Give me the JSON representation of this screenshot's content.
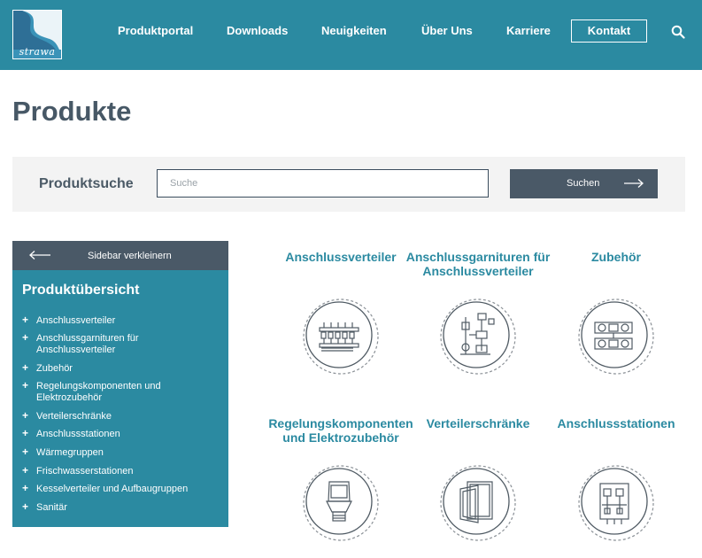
{
  "header": {
    "logo_text": "strawa",
    "nav": [
      "Produktportal",
      "Downloads",
      "Neuigkeiten",
      "Über Uns",
      "Karriere"
    ],
    "contact_label": "Kontakt"
  },
  "page": {
    "title": "Produkte"
  },
  "search": {
    "label": "Produktsuche",
    "placeholder": "Suche",
    "button_label": "Suchen"
  },
  "sidebar": {
    "toggle_label": "Sidebar verkleinern",
    "title": "Produktübersicht",
    "items": [
      "Anschlussverteiler",
      "Anschlussgarnituren für Anschlussverteiler",
      "Zubehör",
      "Regelungskomponenten und Elektrozubehör",
      "Verteilerschränke",
      "Anschlussstationen",
      "Wärmegruppen",
      "Frischwasserstationen",
      "Kesselverteiler und Aufbaugruppen",
      "Sanitär"
    ]
  },
  "products": [
    {
      "title": "Anschlussverteiler",
      "icon": "manifold-icon"
    },
    {
      "title": "Anschlussgarnituren für Anschlussverteiler",
      "icon": "fittings-icon"
    },
    {
      "title": "Zubehör",
      "icon": "accessories-icon"
    },
    {
      "title": "Regelungskomponenten und Elektrozubehör",
      "icon": "actuator-icon"
    },
    {
      "title": "Verteilerschränke",
      "icon": "cabinet-icon"
    },
    {
      "title": "Anschlussstationen",
      "icon": "station-icon"
    }
  ],
  "colors": {
    "brand": "#2b8aa1",
    "dark": "#4a5967",
    "title": "#475866"
  }
}
